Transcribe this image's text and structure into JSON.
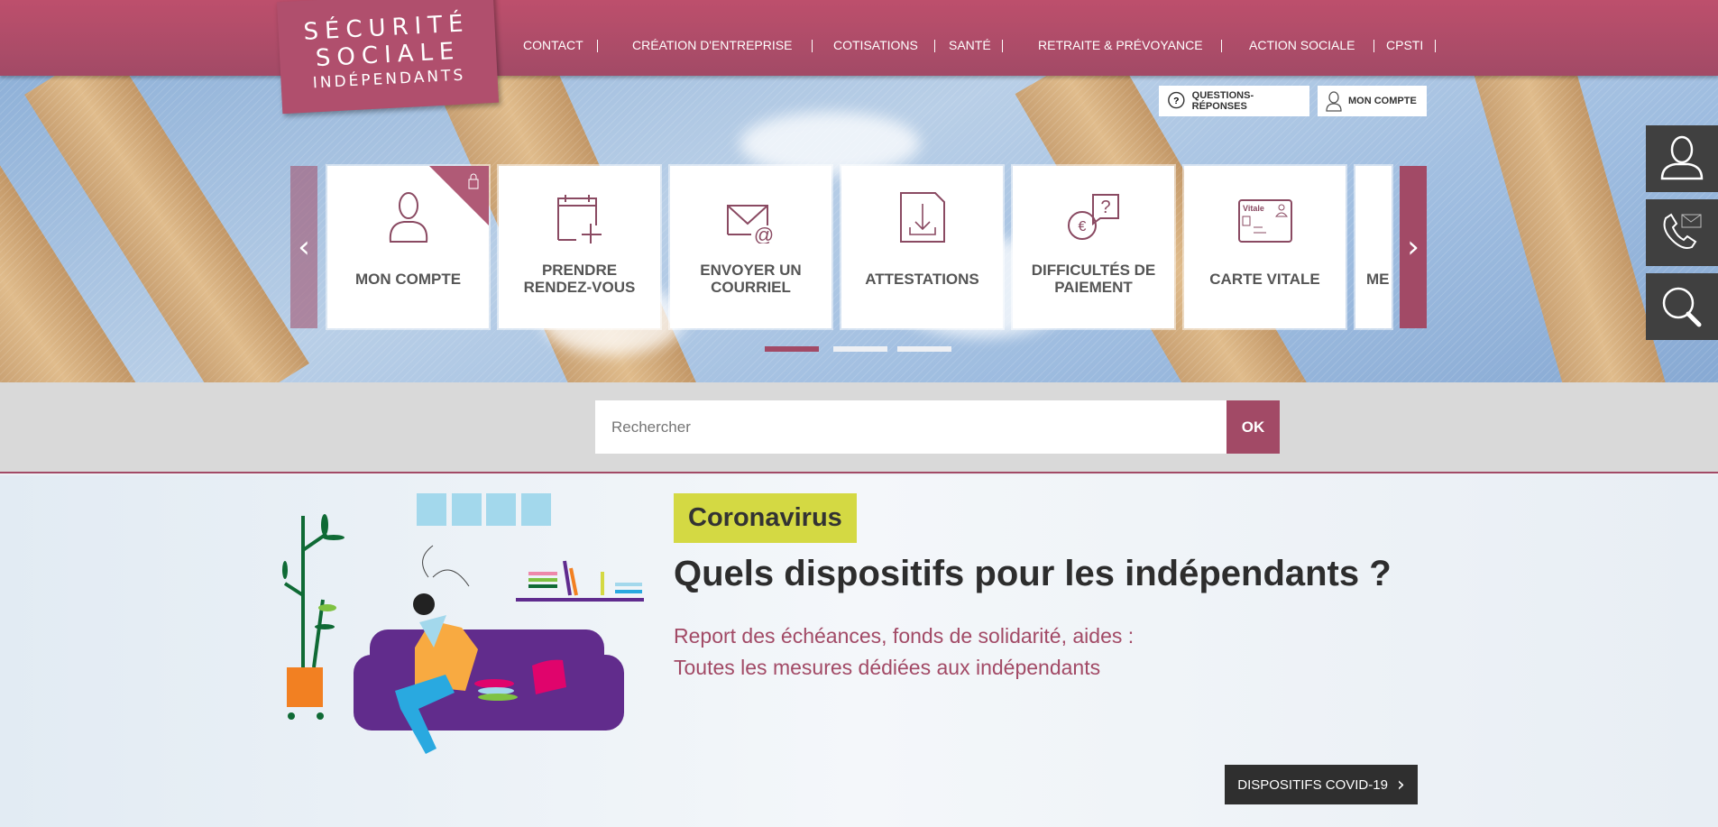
{
  "logo": {
    "line1": "SÉCURITÉ",
    "line2": "SOCIALE",
    "line3": "INDÉPENDANTS"
  },
  "nav": [
    "CONTACT",
    "CRÉATION D'ENTREPRISE",
    "COTISATIONS",
    "SANTÉ",
    "RETRAITE & PRÉVOYANCE",
    "ACTION SOCIALE",
    "CPSTI"
  ],
  "top_buttons": {
    "faq": "QUESTIONS-RÉPONSES",
    "account": "MON COMPTE"
  },
  "carousel": {
    "cards": [
      {
        "label": "MON COMPTE",
        "icon": "user-icon",
        "locked": true
      },
      {
        "label": "PRENDRE RENDEZ-VOUS",
        "icon": "calendar-add-icon"
      },
      {
        "label": "ENVOYER UN COURRIEL",
        "icon": "email-icon"
      },
      {
        "label": "ATTESTATIONS",
        "icon": "document-download-icon"
      },
      {
        "label": "DIFFICULTÉS DE PAIEMENT",
        "icon": "euro-question-icon"
      },
      {
        "label": "CARTE VITALE",
        "icon": "vitale-card-icon"
      },
      {
        "label": "ME",
        "icon": ""
      }
    ],
    "active_page": 1,
    "pages": 3
  },
  "search": {
    "placeholder": "Rechercher",
    "button": "OK"
  },
  "feature": {
    "badge": "Coronavirus",
    "title": "Quels dispositifs pour les indépendants ?",
    "line1": "Report des échéances, fonds de solidarité, aides :",
    "line2": "Toutes les mesures dédiées aux indépendants",
    "button": "DISPOSITIFS COVID-19"
  },
  "colors": {
    "brand": "#a24a66",
    "badge": "#d4d943",
    "dark": "#404040"
  }
}
